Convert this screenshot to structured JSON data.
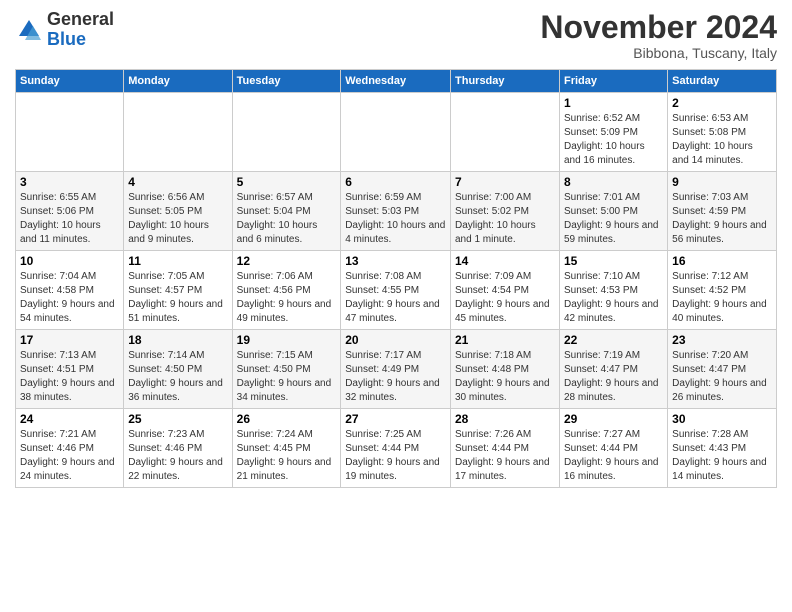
{
  "logo": {
    "general": "General",
    "blue": "Blue"
  },
  "header": {
    "month": "November 2024",
    "location": "Bibbona, Tuscany, Italy"
  },
  "days_of_week": [
    "Sunday",
    "Monday",
    "Tuesday",
    "Wednesday",
    "Thursday",
    "Friday",
    "Saturday"
  ],
  "weeks": [
    [
      {
        "day": "",
        "info": ""
      },
      {
        "day": "",
        "info": ""
      },
      {
        "day": "",
        "info": ""
      },
      {
        "day": "",
        "info": ""
      },
      {
        "day": "",
        "info": ""
      },
      {
        "day": "1",
        "info": "Sunrise: 6:52 AM\nSunset: 5:09 PM\nDaylight: 10 hours and 16 minutes."
      },
      {
        "day": "2",
        "info": "Sunrise: 6:53 AM\nSunset: 5:08 PM\nDaylight: 10 hours and 14 minutes."
      }
    ],
    [
      {
        "day": "3",
        "info": "Sunrise: 6:55 AM\nSunset: 5:06 PM\nDaylight: 10 hours and 11 minutes."
      },
      {
        "day": "4",
        "info": "Sunrise: 6:56 AM\nSunset: 5:05 PM\nDaylight: 10 hours and 9 minutes."
      },
      {
        "day": "5",
        "info": "Sunrise: 6:57 AM\nSunset: 5:04 PM\nDaylight: 10 hours and 6 minutes."
      },
      {
        "day": "6",
        "info": "Sunrise: 6:59 AM\nSunset: 5:03 PM\nDaylight: 10 hours and 4 minutes."
      },
      {
        "day": "7",
        "info": "Sunrise: 7:00 AM\nSunset: 5:02 PM\nDaylight: 10 hours and 1 minute."
      },
      {
        "day": "8",
        "info": "Sunrise: 7:01 AM\nSunset: 5:00 PM\nDaylight: 9 hours and 59 minutes."
      },
      {
        "day": "9",
        "info": "Sunrise: 7:03 AM\nSunset: 4:59 PM\nDaylight: 9 hours and 56 minutes."
      }
    ],
    [
      {
        "day": "10",
        "info": "Sunrise: 7:04 AM\nSunset: 4:58 PM\nDaylight: 9 hours and 54 minutes."
      },
      {
        "day": "11",
        "info": "Sunrise: 7:05 AM\nSunset: 4:57 PM\nDaylight: 9 hours and 51 minutes."
      },
      {
        "day": "12",
        "info": "Sunrise: 7:06 AM\nSunset: 4:56 PM\nDaylight: 9 hours and 49 minutes."
      },
      {
        "day": "13",
        "info": "Sunrise: 7:08 AM\nSunset: 4:55 PM\nDaylight: 9 hours and 47 minutes."
      },
      {
        "day": "14",
        "info": "Sunrise: 7:09 AM\nSunset: 4:54 PM\nDaylight: 9 hours and 45 minutes."
      },
      {
        "day": "15",
        "info": "Sunrise: 7:10 AM\nSunset: 4:53 PM\nDaylight: 9 hours and 42 minutes."
      },
      {
        "day": "16",
        "info": "Sunrise: 7:12 AM\nSunset: 4:52 PM\nDaylight: 9 hours and 40 minutes."
      }
    ],
    [
      {
        "day": "17",
        "info": "Sunrise: 7:13 AM\nSunset: 4:51 PM\nDaylight: 9 hours and 38 minutes."
      },
      {
        "day": "18",
        "info": "Sunrise: 7:14 AM\nSunset: 4:50 PM\nDaylight: 9 hours and 36 minutes."
      },
      {
        "day": "19",
        "info": "Sunrise: 7:15 AM\nSunset: 4:50 PM\nDaylight: 9 hours and 34 minutes."
      },
      {
        "day": "20",
        "info": "Sunrise: 7:17 AM\nSunset: 4:49 PM\nDaylight: 9 hours and 32 minutes."
      },
      {
        "day": "21",
        "info": "Sunrise: 7:18 AM\nSunset: 4:48 PM\nDaylight: 9 hours and 30 minutes."
      },
      {
        "day": "22",
        "info": "Sunrise: 7:19 AM\nSunset: 4:47 PM\nDaylight: 9 hours and 28 minutes."
      },
      {
        "day": "23",
        "info": "Sunrise: 7:20 AM\nSunset: 4:47 PM\nDaylight: 9 hours and 26 minutes."
      }
    ],
    [
      {
        "day": "24",
        "info": "Sunrise: 7:21 AM\nSunset: 4:46 PM\nDaylight: 9 hours and 24 minutes."
      },
      {
        "day": "25",
        "info": "Sunrise: 7:23 AM\nSunset: 4:46 PM\nDaylight: 9 hours and 22 minutes."
      },
      {
        "day": "26",
        "info": "Sunrise: 7:24 AM\nSunset: 4:45 PM\nDaylight: 9 hours and 21 minutes."
      },
      {
        "day": "27",
        "info": "Sunrise: 7:25 AM\nSunset: 4:44 PM\nDaylight: 9 hours and 19 minutes."
      },
      {
        "day": "28",
        "info": "Sunrise: 7:26 AM\nSunset: 4:44 PM\nDaylight: 9 hours and 17 minutes."
      },
      {
        "day": "29",
        "info": "Sunrise: 7:27 AM\nSunset: 4:44 PM\nDaylight: 9 hours and 16 minutes."
      },
      {
        "day": "30",
        "info": "Sunrise: 7:28 AM\nSunset: 4:43 PM\nDaylight: 9 hours and 14 minutes."
      }
    ]
  ]
}
